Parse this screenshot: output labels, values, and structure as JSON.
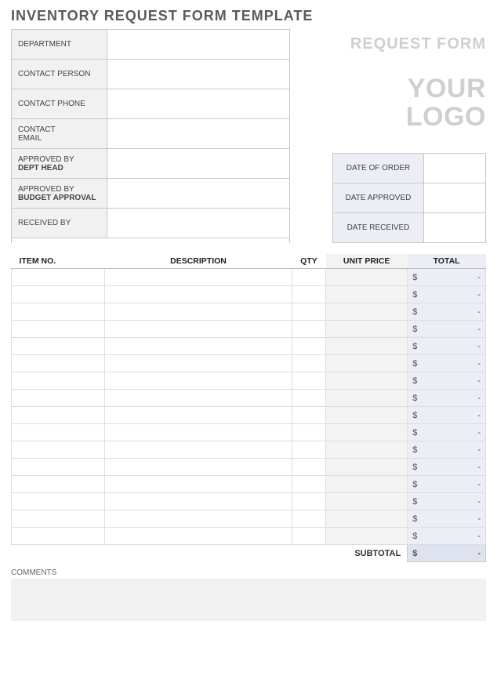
{
  "title": "INVENTORY REQUEST FORM TEMPLATE",
  "request_form_text": "REQUEST FORM",
  "logo_line1": "YOUR",
  "logo_line2": "LOGO",
  "info_rows": [
    {
      "label1": "DEPARTMENT",
      "label2": ""
    },
    {
      "label1": "CONTACT PERSON",
      "label2": ""
    },
    {
      "label1": "CONTACT PHONE",
      "label2": ""
    },
    {
      "label1": "CONTACT",
      "label2": "EMAIL",
      "label2_bold": false
    },
    {
      "label1": "APPROVED BY",
      "label2": "DEPT HEAD"
    },
    {
      "label1": "APPROVED BY",
      "label2": "BUDGET APPROVAL"
    },
    {
      "label1": "RECEIVED BY",
      "label2": ""
    }
  ],
  "date_rows": [
    {
      "label": "DATE OF ORDER"
    },
    {
      "label": "DATE APPROVED"
    },
    {
      "label": "DATE RECEIVED"
    }
  ],
  "table": {
    "headers": {
      "item_no": "ITEM NO.",
      "description": "DESCRIPTION",
      "qty": "QTY",
      "unit_price": "UNIT PRICE",
      "total": "TOTAL"
    },
    "currency": "$",
    "dash": "-",
    "row_count": 16,
    "subtotal_label": "SUBTOTAL",
    "subtotal_currency": "$",
    "subtotal_value": "-"
  },
  "comments_label": "COMMENTS"
}
